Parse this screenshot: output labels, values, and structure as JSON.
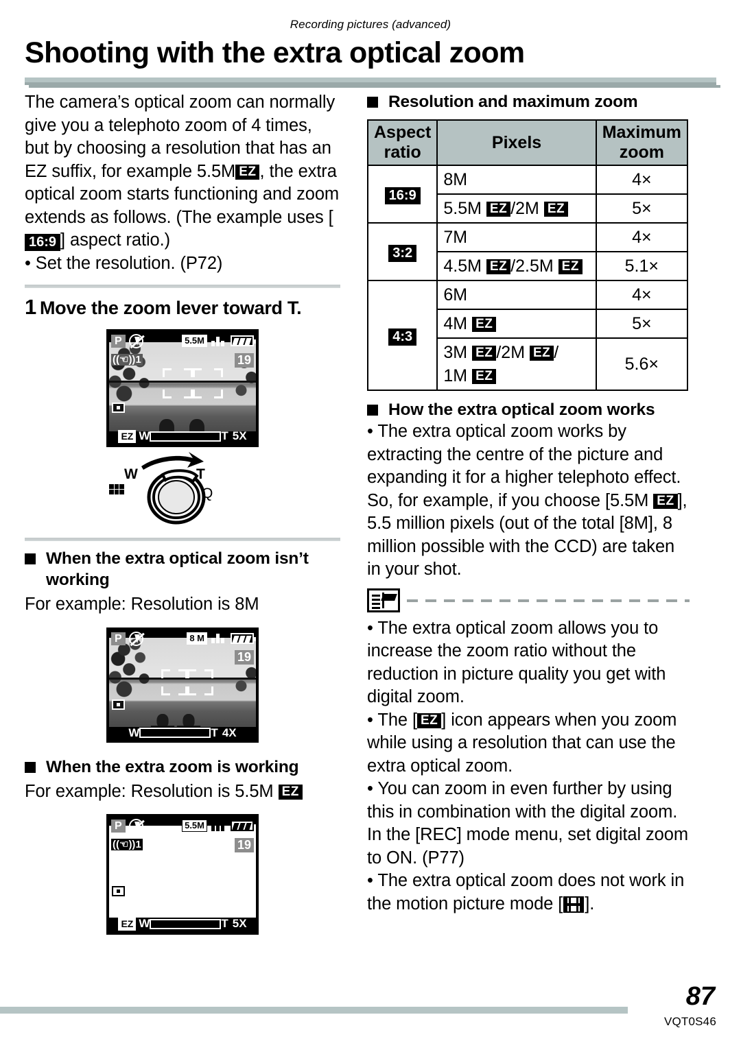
{
  "header": {
    "running_head": "Recording pictures (advanced)",
    "title": "Shooting with the extra optical zoom"
  },
  "left_column": {
    "intro_part1": "The camera’s optical zoom can normally give you a telephoto zoom of 4 times, but by choosing a resolution that has an EZ suffix, for example 5.5M",
    "intro_ez": "EZ",
    "intro_part2": ", the extra optical zoom starts functioning and zoom extends as follows. (The example uses [",
    "intro_ratio": "16:9",
    "intro_part3": "] aspect ratio.)",
    "set_resolution_bullet": "• Set the resolution. (P72)",
    "step_number": "1",
    "step_label": "Move the zoom lever toward T.",
    "lever": {
      "wide_label": "W",
      "tele_label": "T",
      "magnify_label": "Q",
      "multi_icon": "multi-playback-icon"
    },
    "section_not_working": {
      "heading_line1": "When the extra optical zoom isn’t",
      "heading_line2": "working",
      "example": "For example: Resolution is 8M"
    },
    "section_working": {
      "heading": "When the extra zoom is working",
      "example_prefix": "For example: Resolution is 5.5M",
      "example_ez": "EZ"
    }
  },
  "lcd_screens": [
    {
      "id": "lcd-zoom-t",
      "mode": "P",
      "flash": "flash-off-icon",
      "resolution": "5.5M",
      "quality": "quality-fine-icon",
      "battery": "battery-full-icon",
      "stabilizer": "1",
      "shots_remaining": "19",
      "metering": "spot-metering-icon",
      "ez_badge": "EZ",
      "zoom_wide": "W",
      "zoom_tele": "T",
      "zoom_value": "5X",
      "has_photo": true
    },
    {
      "id": "lcd-8m",
      "mode": "P",
      "flash": "flash-off-icon",
      "resolution": "8 M",
      "quality": "quality-fine-icon",
      "battery": "battery-full-icon",
      "stabilizer": "",
      "shots_remaining": "19",
      "metering": "spot-metering-icon",
      "ez_badge": "",
      "zoom_wide": "W",
      "zoom_tele": "T",
      "zoom_value": "4X",
      "has_photo": true
    },
    {
      "id": "lcd-ez-working",
      "mode": "P",
      "flash": "flash-off-icon",
      "resolution": "5.5M",
      "quality": "quality-fine-icon",
      "battery": "battery-full-icon",
      "stabilizer": "1",
      "shots_remaining": "19",
      "metering": "spot-metering-icon",
      "ez_badge": "EZ",
      "zoom_wide": "W",
      "zoom_tele": "T",
      "zoom_value": "5X",
      "has_photo": false
    }
  ],
  "right_column": {
    "table_heading": "Resolution and maximum zoom",
    "table": {
      "columns": [
        "Aspect ratio",
        "Pixels",
        "Maximum zoom"
      ],
      "col_aspect_line1": "Aspect",
      "col_aspect_line2": "ratio",
      "col_pixels": "Pixels",
      "col_zoom_line1": "Maximum",
      "col_zoom_line2": "zoom",
      "groups": [
        {
          "aspect": "16:9",
          "rows": [
            {
              "pixels": [
                {
                  "t": "8M"
                }
              ],
              "zoom": "4×"
            },
            {
              "pixels": [
                {
                  "t": "5.5M "
                },
                {
                  "ez": "EZ"
                },
                {
                  "t": "/2M "
                },
                {
                  "ez": "EZ"
                }
              ],
              "zoom": "5×"
            }
          ]
        },
        {
          "aspect": "3:2",
          "rows": [
            {
              "pixels": [
                {
                  "t": "7M"
                }
              ],
              "zoom": "4×"
            },
            {
              "pixels": [
                {
                  "t": "4.5M "
                },
                {
                  "ez": "EZ"
                },
                {
                  "t": "/2.5M "
                },
                {
                  "ez": "EZ"
                }
              ],
              "zoom": "5.1×"
            }
          ]
        },
        {
          "aspect": "4:3",
          "rows": [
            {
              "pixels": [
                {
                  "t": "6M"
                }
              ],
              "zoom": "4×"
            },
            {
              "pixels": [
                {
                  "t": "4M "
                },
                {
                  "ez": "EZ"
                }
              ],
              "zoom": "5×"
            },
            {
              "pixels": [
                {
                  "t": "3M "
                },
                {
                  "ez": "EZ"
                },
                {
                  "t": "/2M "
                },
                {
                  "ez": "EZ"
                },
                {
                  "t": "/"
                },
                {
                  "br": true
                },
                {
                  "t": "1M "
                },
                {
                  "ez": "EZ"
                }
              ],
              "zoom": "5.6×"
            }
          ]
        }
      ]
    },
    "how_heading": "How the extra optical zoom works",
    "how_text_part1": "• The extra optical zoom works by extracting the centre of the picture and expanding it for a higher telephoto effect. So, for example, if you choose [5.5M",
    "how_ez": "EZ",
    "how_text_part2": "], 5.5 million pixels (out of the total [8M], 8 million possible with the CCD) are taken in your shot.",
    "note_icon": "note-book-icon",
    "notes": [
      {
        "text": "• The extra optical zoom allows you to increase the zoom ratio without the reduction in picture quality you get with digital zoom."
      },
      {
        "prefix": "• The [",
        "ez": "EZ",
        "suffix": "] icon appears when you zoom while using a resolution that can use the extra optical zoom."
      },
      {
        "text": "• You can zoom in even further by using this in combination with the digital zoom. In the [REC] mode menu, set digital zoom to ON. (P77)"
      },
      {
        "prefix": "• The extra optical zoom does not work in the motion picture mode [",
        "movie_icon": "motion-picture-mode-icon",
        "suffix": "]."
      }
    ]
  },
  "footer": {
    "page_number": "87",
    "doc_code": "VQT0S46"
  },
  "colors": {
    "bar": "#b5c4c4",
    "table_header": "#b5c2c2",
    "rule": "#c6cccd"
  }
}
